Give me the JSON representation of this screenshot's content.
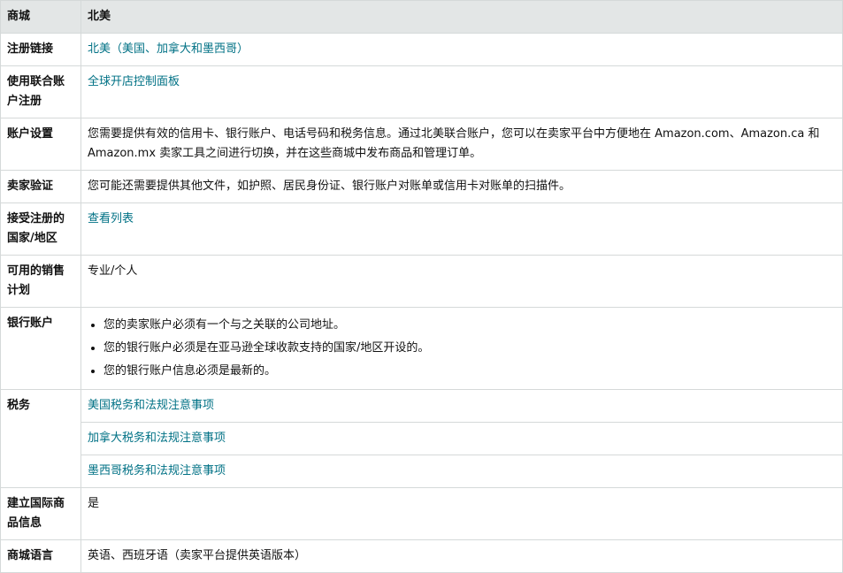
{
  "header": {
    "col1": "商城",
    "col2": "北美"
  },
  "rows": {
    "register": {
      "label": "注册链接",
      "link": "北美（美国、加拿大和墨西哥）"
    },
    "unified": {
      "label": "使用联合账户注册",
      "link": "全球开店控制面板"
    },
    "account": {
      "label": "账户设置",
      "text": "您需要提供有效的信用卡、银行账户、电话号码和税务信息。通过北美联合账户，您可以在卖家平台中方便地在 Amazon.com、Amazon.ca 和 Amazon.mx 卖家工具之间进行切换，并在这些商城中发布商品和管理订单。"
    },
    "verify": {
      "label": "卖家验证",
      "text": "您可能还需要提供其他文件，如护照、居民身份证、银行账户对账单或信用卡对账单的扫描件。"
    },
    "countries": {
      "label": "接受注册的国家/地区",
      "link": "查看列表"
    },
    "plans": {
      "label": "可用的销售计划",
      "text": "专业/个人"
    },
    "bank": {
      "label": "银行账户",
      "items": [
        "您的卖家账户必须有一个与之关联的公司地址。",
        "您的银行账户必须是在亚马逊全球收款支持的国家/地区开设的。",
        "您的银行账户信息必须是最新的。"
      ]
    },
    "tax": {
      "label": "税务",
      "links": [
        "美国税务和法规注意事项",
        "加拿大税务和法规注意事项",
        "墨西哥税务和法规注意事项"
      ]
    },
    "intl": {
      "label": "建立国际商品信息",
      "text": "是"
    },
    "lang": {
      "label": "商城语言",
      "text": "英语、西班牙语（卖家平台提供英语版本）"
    }
  }
}
